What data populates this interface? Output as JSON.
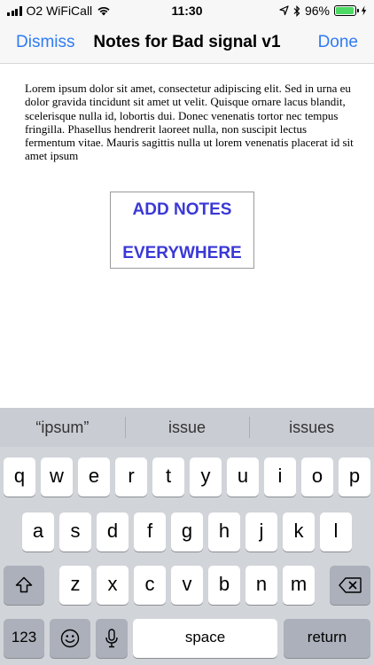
{
  "status_bar": {
    "carrier": "O2 WiFiCall",
    "time": "11:30",
    "battery_percent_label": "96%",
    "battery_level": 0.96,
    "icons": [
      "signal-bars-icon",
      "wifi-icon",
      "location-arrow-icon",
      "bluetooth-icon",
      "battery-icon",
      "charging-bolt-icon"
    ]
  },
  "nav": {
    "left_label": "Dismiss",
    "title": "Notes for Bad signal v1",
    "right_label": "Done",
    "accent_color": "#2f7bf5"
  },
  "content": {
    "body_text": "Lorem ipsum dolor sit amet, consectetur adipiscing elit. Sed in urna eu dolor gravida tincidunt sit amet ut velit. Quisque ornare lacus blandit, scelerisque nulla id, lobortis dui. Donec venenatis tortor nec tempus fringilla. Phasellus hendrerit laoreet nulla, non suscipit lectus fermentum vitae. Mauris sagittis nulla ut lorem venenatis placerat id sit amet ipsum",
    "notes_line1": "ADD NOTES",
    "notes_line2": "EVERYWHERE",
    "notes_color": "#3a38d6"
  },
  "keyboard": {
    "suggestions": [
      "“ipsum”",
      "issue",
      "issues"
    ],
    "row1": [
      "q",
      "w",
      "e",
      "r",
      "t",
      "y",
      "u",
      "i",
      "o",
      "p"
    ],
    "row2": [
      "a",
      "s",
      "d",
      "f",
      "g",
      "h",
      "j",
      "k",
      "l"
    ],
    "row3": [
      "z",
      "x",
      "c",
      "v",
      "b",
      "n",
      "m"
    ],
    "numbers_label": "123",
    "space_label": "space",
    "return_label": "return",
    "shift_icon": "shift-icon",
    "delete_icon": "delete-icon",
    "emoji_icon": "emoji-icon",
    "mic_icon": "microphone-icon"
  }
}
